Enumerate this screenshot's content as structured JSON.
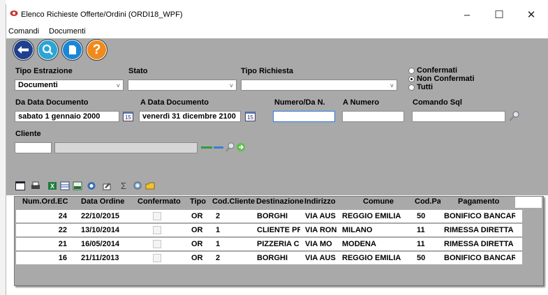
{
  "window": {
    "title": "Elenco Richieste Offerte/Ordini (ORDI18_WPF)",
    "minimize": "–",
    "maximize": "☐",
    "close": "✕"
  },
  "menu": {
    "items": [
      "Comandi",
      "Documenti"
    ]
  },
  "toolbar": {
    "buttons": [
      "back-icon",
      "search-icon",
      "new-document-icon",
      "help-icon"
    ],
    "help_label": "?"
  },
  "filters": {
    "tipo_estrazione": {
      "label": "Tipo Estrazione",
      "value": "Documenti"
    },
    "stato": {
      "label": "Stato",
      "value": ""
    },
    "tipo_richiesta": {
      "label": "Tipo Richiesta",
      "value": ""
    },
    "radio_options": [
      "Confermati",
      "Non Confermati",
      "Tutti"
    ],
    "radio_selected": "Non Confermati",
    "da_data": {
      "label": "Da Data Documento",
      "value": "sabato 1 gennaio 2000"
    },
    "a_data": {
      "label": "A Data Documento",
      "value": "venerdì 31 dicembre 2100"
    },
    "calendar_label": "15",
    "numero_da": {
      "label": "Numero/Da N.",
      "value": ""
    },
    "a_numero": {
      "label": "A Numero",
      "value": ""
    },
    "comando_sql": {
      "label": "Comando Sql",
      "value": ""
    },
    "cliente": {
      "label": "Cliente",
      "code": "",
      "name": ""
    }
  },
  "grid_toolbar": {
    "sigma": "Σ"
  },
  "grid": {
    "columns": [
      "Num.Ord.EC",
      "Data Ordine",
      "Confermato",
      "Tipo",
      "Cod.Cliente",
      "Destinazione",
      "Indirizzo",
      "Comune",
      "Cod.Pa",
      "Pagamento"
    ],
    "rows": [
      {
        "num": "24",
        "data": "22/10/2015",
        "confermato": false,
        "tipo": "OR",
        "cod_cliente": "2",
        "destinazione": "BORGHI",
        "indirizzo": "VIA AUS",
        "comune": "REGGIO EMILIA",
        "cod_pa": "50",
        "pagamento": "BONIFICO BANCAR"
      },
      {
        "num": "22",
        "data": "13/10/2014",
        "confermato": false,
        "tipo": "OR",
        "cod_cliente": "1",
        "destinazione": "CLIENTE PR",
        "indirizzo": "VIA RON",
        "comune": "MILANO",
        "cod_pa": "11",
        "pagamento": "RIMESSA DIRETTA"
      },
      {
        "num": "21",
        "data": "16/05/2014",
        "confermato": false,
        "tipo": "OR",
        "cod_cliente": "1",
        "destinazione": "PIZZERIA C",
        "indirizzo": "VIA MO",
        "comune": "MODENA",
        "cod_pa": "11",
        "pagamento": "RIMESSA DIRETTA"
      },
      {
        "num": "16",
        "data": "21/11/2013",
        "confermato": false,
        "tipo": "OR",
        "cod_cliente": "2",
        "destinazione": "BORGHI",
        "indirizzo": "VIA AUS",
        "comune": "REGGIO EMILIA",
        "cod_pa": "50",
        "pagamento": "BONIFICO BANCAR"
      }
    ]
  }
}
